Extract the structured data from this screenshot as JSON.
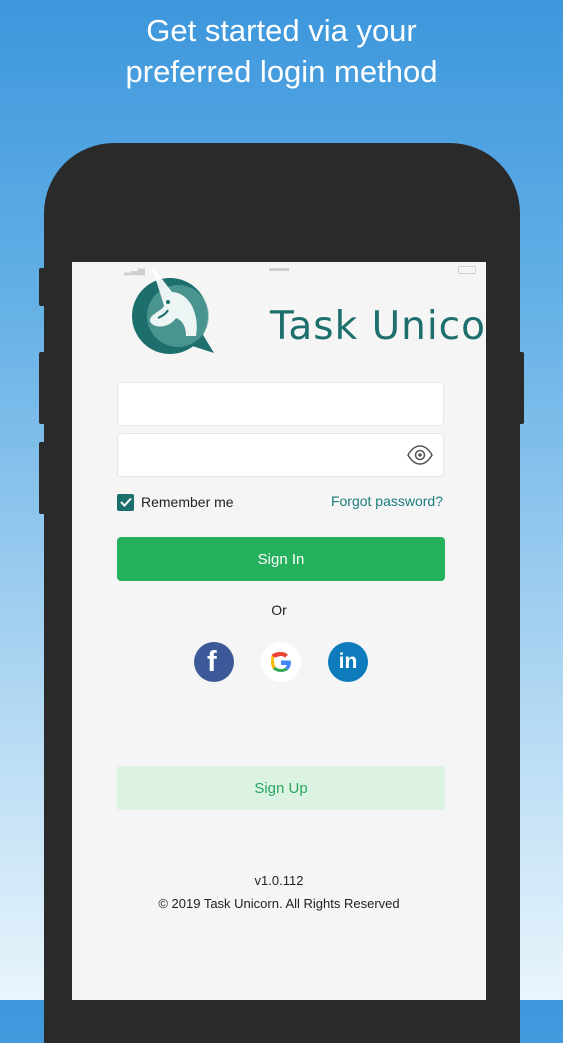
{
  "headline": {
    "line1": "Get started via your",
    "line2": "preferred login method"
  },
  "logo": {
    "text": "Task Unicorn"
  },
  "login_form": {
    "username_value": "",
    "password_value": "",
    "remember_me_label": "Remember me",
    "remember_me_checked": true,
    "forgot_password_label": "Forgot password?",
    "sign_in_label": "Sign In",
    "or_label": "Or",
    "sign_up_label": "Sign Up"
  },
  "social_login": {
    "facebook_icon": "facebook-icon",
    "google_icon": "google-icon",
    "linkedin_icon": "linkedin-icon"
  },
  "footer": {
    "version": "v1.0.112",
    "copyright": "© 2019 Task Unicorn. All Rights Reserved"
  },
  "colors": {
    "primary_green": "#25b05c",
    "teal_brand": "#1d6f6d",
    "signup_bg": "#dcf3e3",
    "background_blue": "#3d97dc"
  }
}
